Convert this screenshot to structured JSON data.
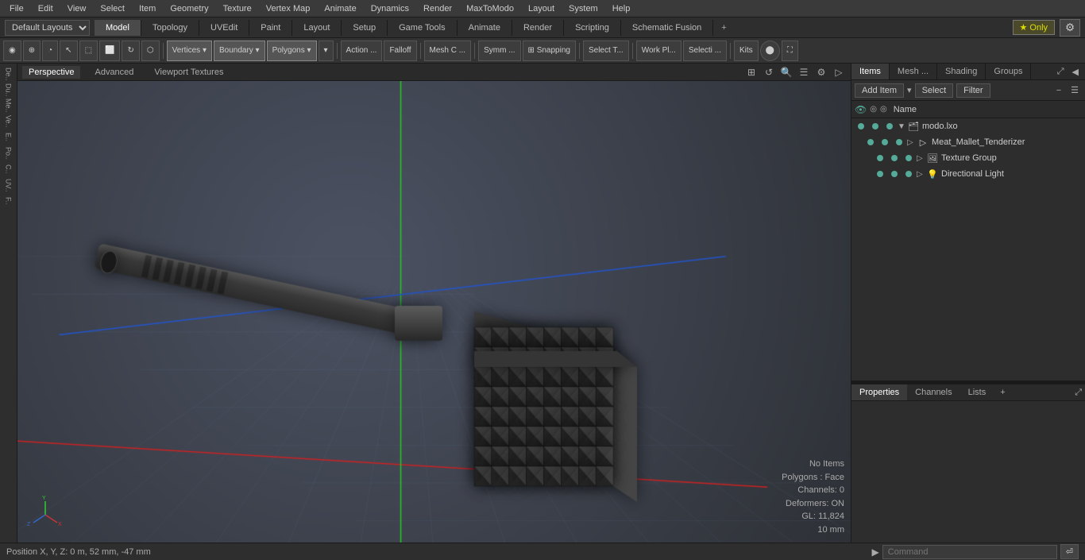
{
  "menubar": {
    "items": [
      "File",
      "Edit",
      "View",
      "Select",
      "Item",
      "Geometry",
      "Texture",
      "Vertex Map",
      "Animate",
      "Dynamics",
      "Render",
      "MaxToModo",
      "Layout",
      "System",
      "Help"
    ]
  },
  "layoutbar": {
    "layout_select": "Default Layouts",
    "tabs": [
      "Model",
      "Topology",
      "UVEdit",
      "Paint",
      "Layout",
      "Setup",
      "Game Tools",
      "Animate",
      "Render",
      "Scripting",
      "Schematic Fusion"
    ],
    "active_tab": "Model",
    "star_only": "★ Only",
    "plus_btn": "+",
    "settings_btn": "⚙"
  },
  "toolbar": {
    "mode_btns": [
      "◉",
      "⊕",
      "◔",
      "↖",
      "⬚",
      "⬜",
      "↻",
      "⬡",
      "▽"
    ],
    "select_btns": [
      "Vertices ▾",
      "Boundary ▾",
      "Polygons ▾",
      "▾"
    ],
    "action_btn": "Action ...",
    "falloff_btn": "Falloff",
    "mesh_btn": "Mesh C ...",
    "symm_btn": "Symm ...",
    "snapping_btn": "⊞ Snapping",
    "select_tool_btn": "Select T...",
    "work_plane_btn": "Work Pl...",
    "selecti_btn": "Selecti ...",
    "kits_btn": "Kits",
    "round_btn": "⬤",
    "fullscreen_btn": "⛶"
  },
  "viewport": {
    "tabs": [
      "Perspective",
      "Advanced",
      "Viewport Textures"
    ],
    "active_tab": "Perspective",
    "controls": [
      "⊞",
      "↺",
      "🔍",
      "☰",
      "⚙",
      "▷"
    ]
  },
  "scene_info": {
    "no_items": "No Items",
    "polygons": "Polygons : Face",
    "channels": "Channels: 0",
    "deformers": "Deformers: ON",
    "gl": "GL: 11,824",
    "unit": "10 mm"
  },
  "right_panel": {
    "tabs": [
      "Items",
      "Mesh ...",
      "Shading",
      "Groups"
    ],
    "active_tab": "Items",
    "add_item": "Add Item",
    "add_item_arrow": "▾",
    "select": "Select",
    "filter": "Filter",
    "collapse_btn": "◀",
    "expand_btn": "▼",
    "name_header": "Name"
  },
  "scene_tree": {
    "items": [
      {
        "id": "modo_lxo",
        "label": "modo.lxo",
        "indent": 0,
        "icon": "🗂",
        "expanded": true,
        "visible": true,
        "selected": false
      },
      {
        "id": "meat_mallet",
        "label": "Meat_Mallet_Tenderizer",
        "indent": 1,
        "icon": "▷",
        "expanded": false,
        "visible": true,
        "selected": false
      },
      {
        "id": "texture_group",
        "label": "Texture Group",
        "indent": 2,
        "icon": "🖼",
        "expanded": false,
        "visible": true,
        "selected": false
      },
      {
        "id": "directional_light",
        "label": "Directional Light",
        "indent": 2,
        "icon": "💡",
        "expanded": false,
        "visible": true,
        "selected": false
      }
    ]
  },
  "properties_panel": {
    "tabs": [
      "Properties",
      "Channels",
      "Lists"
    ],
    "active_tab": "Properties",
    "plus_btn": "+",
    "expand_btn": "⤢"
  },
  "statusbar": {
    "position_text": "Position X, Y, Z:  0 m, 52 mm, -47 mm",
    "cmd_placeholder": "Command",
    "cmd_arrow": "▶",
    "cmd_go": "⏎"
  },
  "left_sidebar": {
    "items": [
      "De...",
      "Du...",
      "Me...",
      "Ve...",
      "E...",
      "Po...",
      "C...",
      "UV...",
      "F.."
    ]
  },
  "colors": {
    "accent_blue": "#4a8cc4",
    "bg_dark": "#2b2b2b",
    "bg_medium": "#2d2d2d",
    "bg_light": "#3a3a3a",
    "selected": "#3d5a7a",
    "grid_line": "#4a5a6a",
    "axis_x": "#cc3333",
    "axis_y": "#33cc33",
    "axis_z": "#3366cc"
  }
}
